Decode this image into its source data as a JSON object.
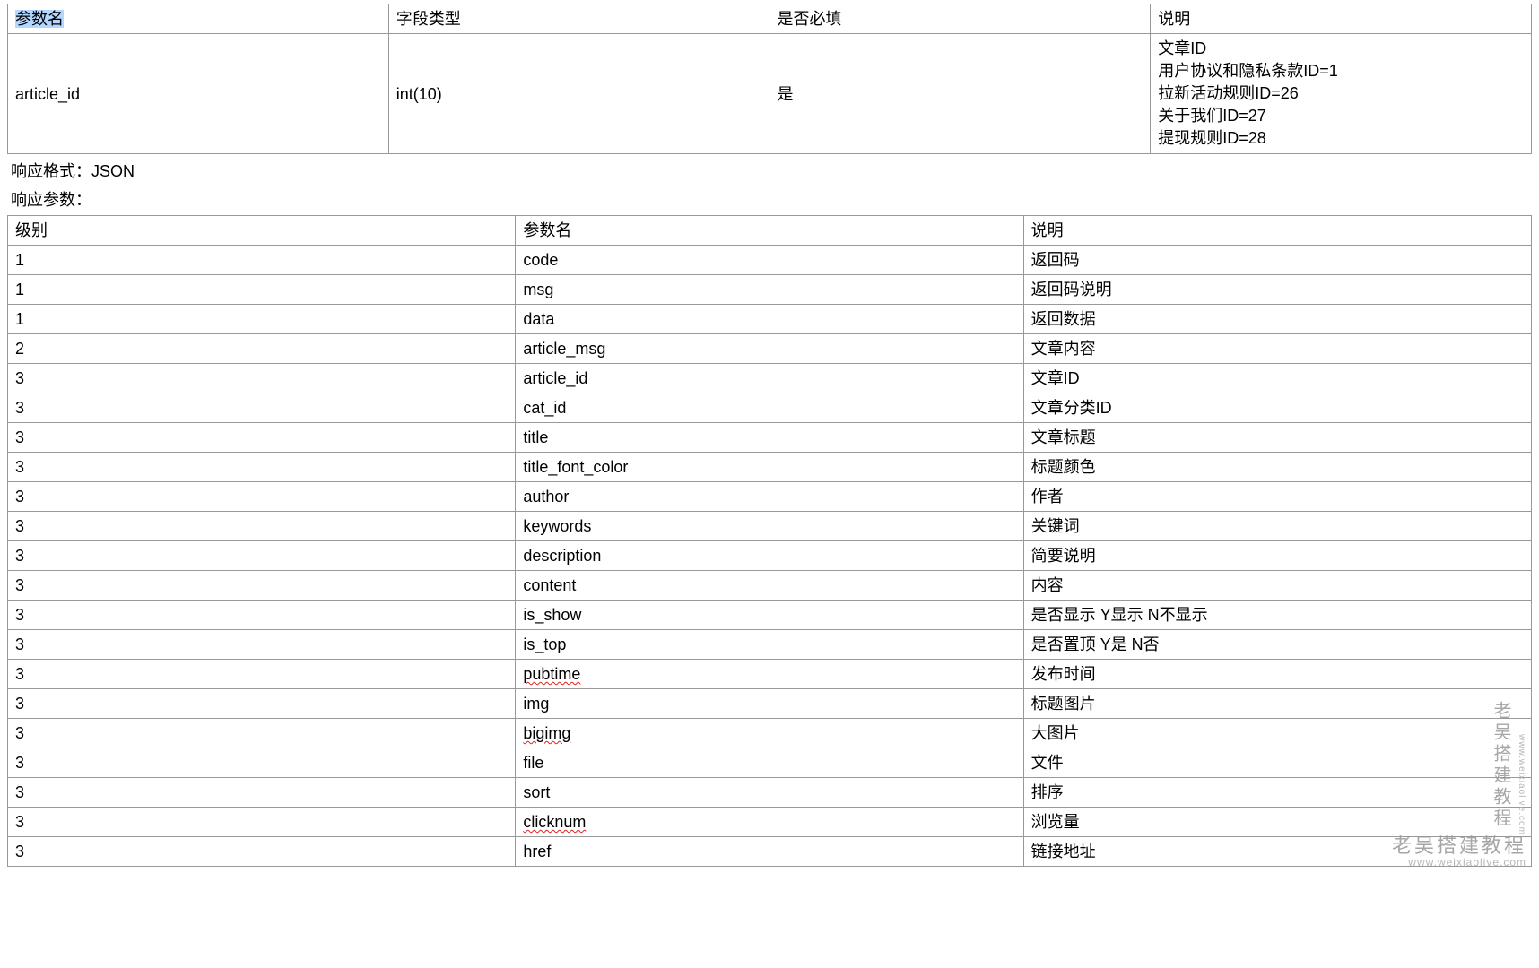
{
  "request_table": {
    "headers": [
      "参数名",
      "字段类型",
      "是否必填",
      "说明"
    ],
    "row": {
      "name": "article_id",
      "type": "int(10)",
      "required": "是",
      "desc_lines": [
        "文章ID",
        "用户协议和隐私条款ID=1",
        "拉新活动规则ID=26",
        "关于我们ID=27",
        "提现规则ID=28"
      ]
    }
  },
  "response_format_label": "响应格式：",
  "response_format_value": "JSON",
  "response_params_label": "响应参数：",
  "response_table": {
    "headers": [
      "级别",
      "参数名",
      "说明"
    ],
    "rows": [
      {
        "level": "1",
        "name": "code",
        "desc": "返回码",
        "squiggle": false
      },
      {
        "level": "1",
        "name": "msg",
        "desc": "返回码说明",
        "squiggle": false
      },
      {
        "level": "1",
        "name": "data",
        "desc": "返回数据",
        "squiggle": false
      },
      {
        "level": "2",
        "name": "article_msg",
        "desc": "文章内容",
        "squiggle": false
      },
      {
        "level": "3",
        "name": "article_id",
        "desc": "文章ID",
        "squiggle": false
      },
      {
        "level": "3",
        "name": "cat_id",
        "desc": "文章分类ID",
        "squiggle": false
      },
      {
        "level": "3",
        "name": "title",
        "desc": "文章标题",
        "squiggle": false
      },
      {
        "level": "3",
        "name": "title_font_color",
        "desc": "标题颜色",
        "squiggle": false
      },
      {
        "level": "3",
        "name": "author",
        "desc": "作者",
        "squiggle": false
      },
      {
        "level": "3",
        "name": "keywords",
        "desc": "关键词",
        "squiggle": false
      },
      {
        "level": "3",
        "name": "description",
        "desc": "简要说明",
        "squiggle": false
      },
      {
        "level": "3",
        "name": "content",
        "desc": "内容",
        "squiggle": false
      },
      {
        "level": "3",
        "name": "is_show",
        "desc": "是否显示 Y显示 N不显示",
        "squiggle": false
      },
      {
        "level": "3",
        "name": "is_top",
        "desc": "是否置顶 Y是 N否",
        "squiggle": false
      },
      {
        "level": "3",
        "name": "pubtime",
        "desc": "发布时间",
        "squiggle": true
      },
      {
        "level": "3",
        "name": "img",
        "desc": "标题图片",
        "squiggle": false
      },
      {
        "level": "3",
        "name": "bigimg",
        "desc": "大图片",
        "squiggle": true
      },
      {
        "level": "3",
        "name": "file",
        "desc": "文件",
        "squiggle": false
      },
      {
        "level": "3",
        "name": "sort",
        "desc": "排序",
        "squiggle": false
      },
      {
        "level": "3",
        "name": "clicknum",
        "desc": "浏览量",
        "squiggle": true
      },
      {
        "level": "3",
        "name": "href",
        "desc": "链接地址",
        "squiggle": false
      }
    ]
  },
  "watermark": {
    "cn": "老吴搭建教程",
    "url": "www.weixiaolive.com",
    "bottom_cn": "老吴搭建教程",
    "bottom_url": "www.weixiaolive.com"
  }
}
